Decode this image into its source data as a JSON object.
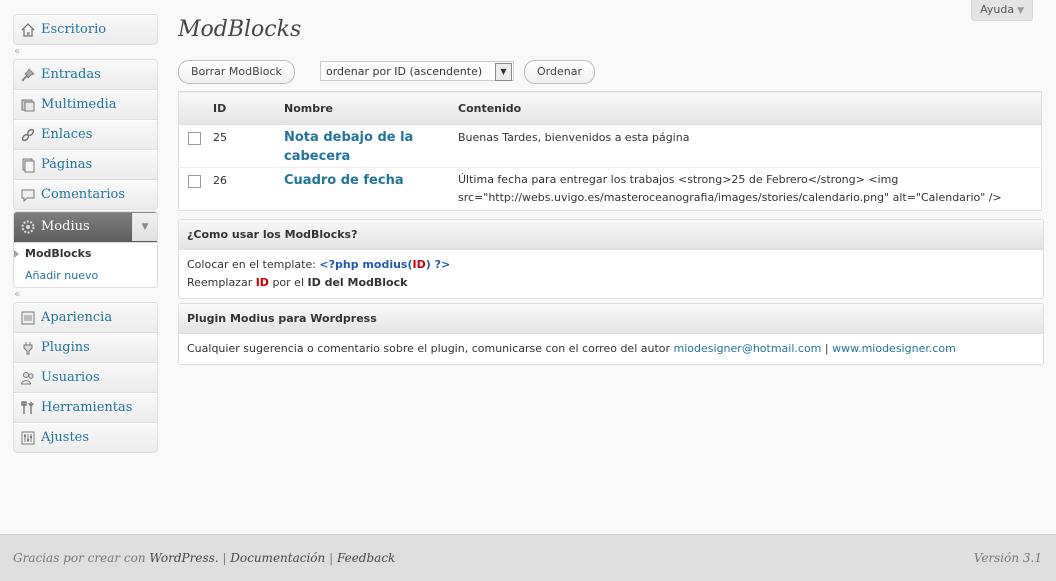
{
  "help": {
    "label": "Ayuda",
    "arrow": "▼"
  },
  "menu": {
    "dashboard": "Escritorio",
    "collapse_glyph": "«",
    "group1": [
      "Entradas",
      "Multimedia",
      "Enlaces",
      "Páginas",
      "Comentarios"
    ],
    "modius": {
      "label": "Modius",
      "toggle": "▼",
      "sub": [
        "ModBlocks",
        "Añadir nuevo"
      ]
    },
    "group2": [
      "Apariencia",
      "Plugins",
      "Usuarios",
      "Herramientas",
      "Ajustes"
    ]
  },
  "page": {
    "title": "ModBlocks",
    "delete_button": "Borrar ModBlock",
    "order_select": "ordenar por ID (ascendente)",
    "order_button": "Ordenar"
  },
  "table": {
    "headers": [
      "ID",
      "Nombre",
      "Contenido"
    ],
    "rows": [
      {
        "id": "25",
        "name_line1": "Nota debajo de la",
        "name_line2": "cabecera",
        "content_line1": "Buenas Tardes, bienvenidos a esta página",
        "content_line2": ""
      },
      {
        "id": "26",
        "name_line1": "Cuadro de fecha",
        "name_line2": "",
        "content_line1": "Última fecha para entregar los trabajos <strong>25 de Febrero</strong> <img",
        "content_line2": "src=\"http://webs.uvigo.es/masteroceanografia/images/stories/calendario.png\" alt=\"Calendario\" />"
      }
    ]
  },
  "howto": {
    "title": "¿Como usar los ModBlocks?",
    "line1_prefix": "Colocar en el template: ",
    "code_open": "<?php modius(",
    "code_id": "ID",
    "code_close": ") ?>",
    "line2_prefix": "Reemplazar ",
    "line2_id": "ID",
    "line2_mid": " por el ",
    "line2_bold": "ID del ModBlock"
  },
  "plugin": {
    "title": "Plugin Modius para Wordpress",
    "text": "Cualquier sugerencia o comentario sobre el plugin, comunicarse con el correo del autor ",
    "email": "miodesigner@hotmail.com",
    "separator": " | ",
    "site": "www.miodesigner.com"
  },
  "footer": {
    "thanks": "Gracias por crear con ",
    "wordpress": "WordPress.",
    "sep1": " | ",
    "docs": "Documentación",
    "sep2": " | ",
    "feedback": "Feedback",
    "version": "Versión 3.1"
  },
  "colors": {
    "link": "#21759b",
    "current_menu": "#6d6d6d",
    "code_blue": "#2258b5",
    "code_red": "#cc0000"
  }
}
